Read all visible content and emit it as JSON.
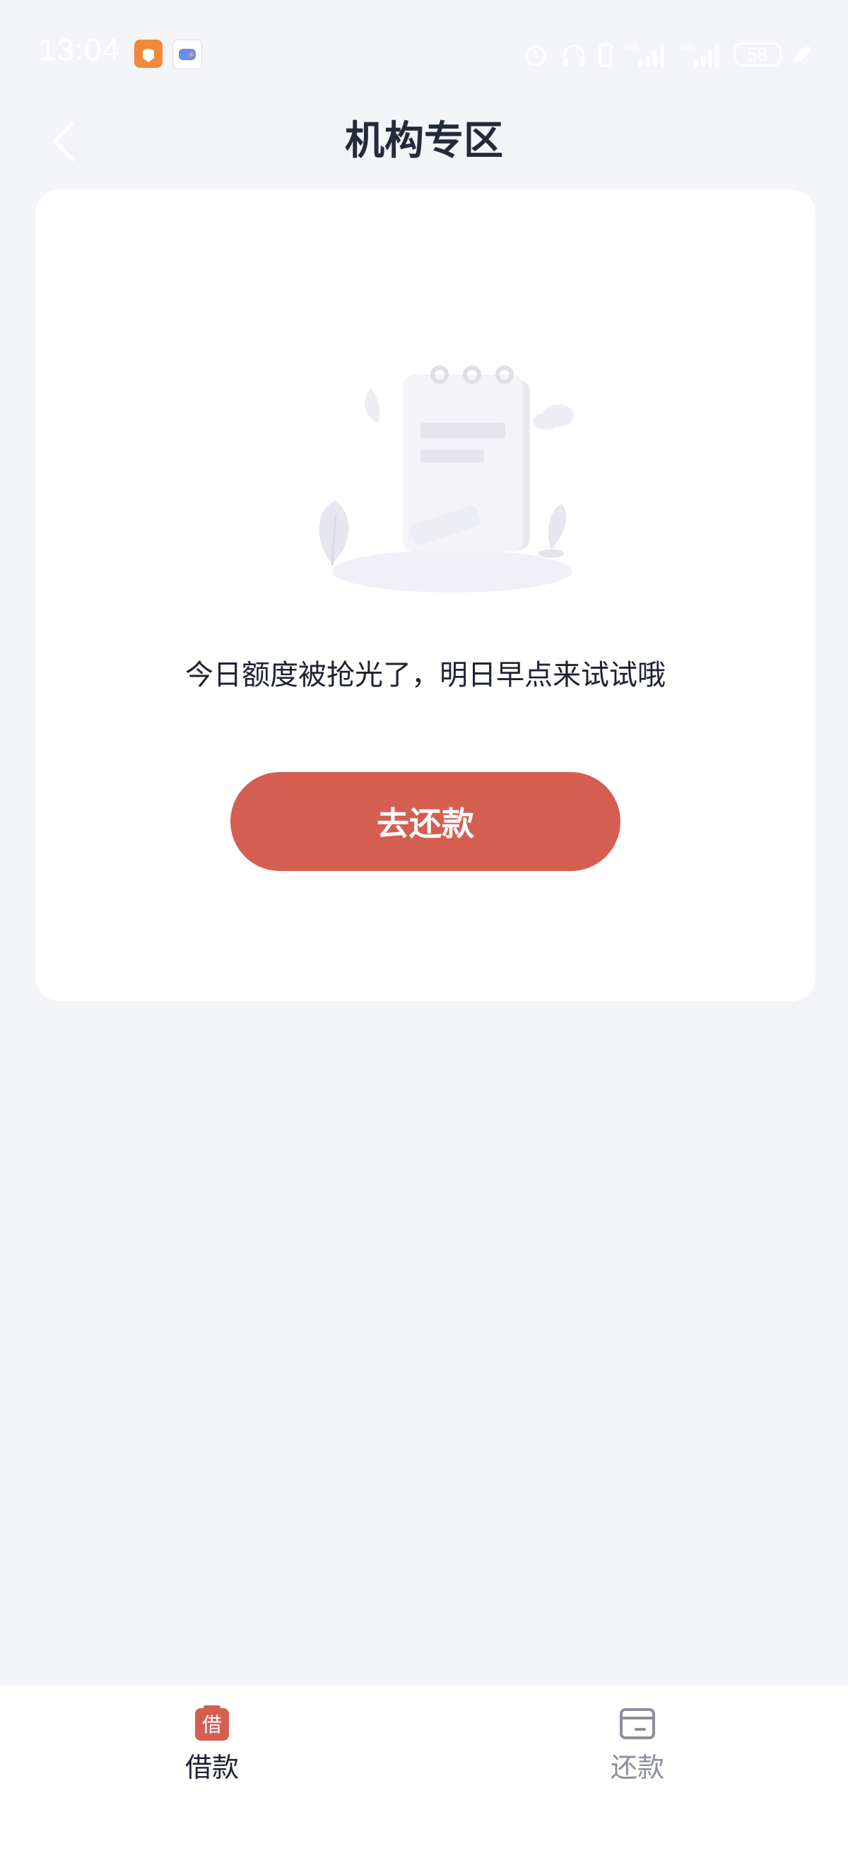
{
  "status_bar": {
    "time": "13:04",
    "battery": "58",
    "icons": [
      "app-notification-icon",
      "game-icon",
      "alarm-icon",
      "headphones-icon",
      "battery-saver-icon",
      "signal-5g-icon",
      "signal-5g-icon",
      "battery-icon",
      "leaf-icon"
    ]
  },
  "header": {
    "title": "机构专区",
    "back_icon": "chevron-left-icon"
  },
  "main": {
    "illustration": "empty-notebook-illustration",
    "empty_message": "今日额度被抢光了，明日早点来试试哦",
    "action_button": "去还款"
  },
  "tab_bar": {
    "tabs": [
      {
        "label": "借款",
        "icon_text": "借",
        "active": true
      },
      {
        "label": "还款",
        "icon": "card-icon",
        "active": false
      }
    ]
  },
  "colors": {
    "accent": "#d45f50",
    "background": "#f4f5f9",
    "title": "#252a3b",
    "inactive": "#8c8f9b"
  }
}
